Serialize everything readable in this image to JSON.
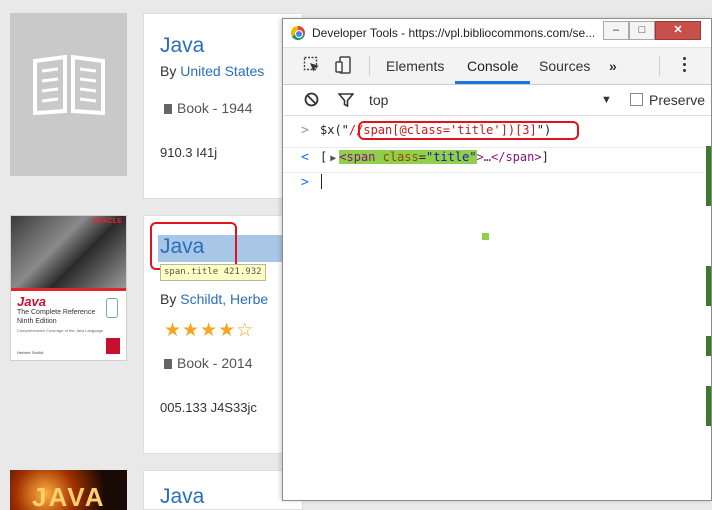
{
  "catalog": {
    "results": [
      {
        "title": "Java",
        "author_prefix": "By",
        "author": "United States",
        "format": "Book - 1944",
        "call_number": "910.3 I41j"
      },
      {
        "title": "Java",
        "author_prefix": "By",
        "author": "Schildt, Herbe",
        "rating_stars": "★★★★☆",
        "rating_value": 4.5,
        "format": "Book - 2014",
        "call_number": "005.133 J4S33jc",
        "cover": {
          "brand": "ORACLE",
          "title": "Java",
          "subtitle": "The Complete Reference",
          "edition": "Ninth Edition",
          "blurb": "Comprehensive Coverage of the Java Language",
          "author": "Herbert Schildt"
        }
      },
      {
        "title": "Java",
        "cover_text": "JAVA"
      }
    ],
    "hover_tooltip": "span.title 421.932"
  },
  "devtools": {
    "window_title": "Developer Tools - https://vpl.bibliocommons.com/se...",
    "window_buttons": {
      "minimize": "–",
      "maximize": "□",
      "close": "✕"
    },
    "tabs": {
      "elements": "Elements",
      "console": "Console",
      "sources": "Sources",
      "more": "»"
    },
    "active_tab": "Console",
    "filter": {
      "context": "top",
      "context_arrow": "▼",
      "preserve_log": "Preserve"
    },
    "console": {
      "input_prompt": ">",
      "input_prefix": "$x(\"",
      "xpath": "//span[@class='title'])[3]",
      "input_suffix": "\")",
      "output_prompt": "<",
      "output_open_bracket": "[",
      "expand_triangle": "▶",
      "element_tag_open": "<span",
      "element_attr": "class",
      "element_attr_value": "\"title\"",
      "element_rest": ">…</span>",
      "output_close_bracket": "]",
      "active_prompt": ">"
    }
  },
  "colors": {
    "link_blue": "#2a6ebb",
    "highlight_red": "#e0141e",
    "console_tab_active": "#1a73e8",
    "element_highlight_green": "#8fcf4c",
    "star_orange": "#f5a623"
  }
}
